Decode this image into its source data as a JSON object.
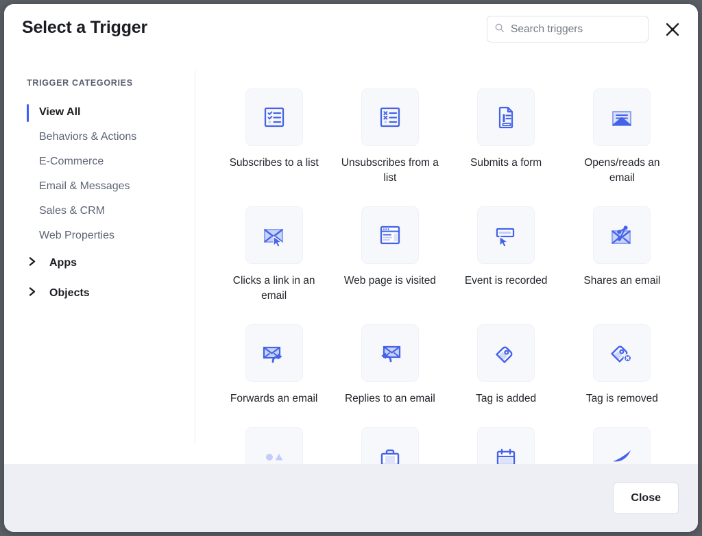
{
  "dialog": {
    "title": "Select a Trigger",
    "close_icon": "close-icon"
  },
  "search": {
    "placeholder": "Search triggers",
    "value": "",
    "icon": "search-icon"
  },
  "sidebar": {
    "heading": "TRIGGER CATEGORIES",
    "items": [
      {
        "label": "View All",
        "active": true
      },
      {
        "label": "Behaviors & Actions",
        "active": false
      },
      {
        "label": "E-Commerce",
        "active": false
      },
      {
        "label": "Email & Messages",
        "active": false
      },
      {
        "label": "Sales & CRM",
        "active": false
      },
      {
        "label": "Web Properties",
        "active": false
      }
    ],
    "groups": [
      {
        "label": "Apps",
        "icon": "chevron-right-icon"
      },
      {
        "label": "Objects",
        "icon": "chevron-right-icon"
      }
    ]
  },
  "triggers": [
    {
      "label": "Subscribes to a list",
      "icon": "list-check-icon"
    },
    {
      "label": "Unsubscribes from a list",
      "icon": "list-x-icon"
    },
    {
      "label": "Submits a form",
      "icon": "document-form-icon"
    },
    {
      "label": "Opens/reads an email",
      "icon": "envelope-open-icon"
    },
    {
      "label": "Clicks a link in an email",
      "icon": "envelope-cursor-icon"
    },
    {
      "label": "Web page is visited",
      "icon": "browser-window-icon"
    },
    {
      "label": "Event is recorded",
      "icon": "tooltip-cursor-icon"
    },
    {
      "label": "Shares an email",
      "icon": "envelope-share-icon"
    },
    {
      "label": "Forwards an email",
      "icon": "envelope-forward-icon"
    },
    {
      "label": "Replies to an email",
      "icon": "envelope-reply-icon"
    },
    {
      "label": "Tag is added",
      "icon": "tag-icon"
    },
    {
      "label": "Tag is removed",
      "icon": "tag-remove-icon"
    },
    {
      "label": "",
      "icon": "shapes-icon"
    },
    {
      "label": "",
      "icon": "briefcase-icon"
    },
    {
      "label": "",
      "icon": "calendar-icon"
    },
    {
      "label": "",
      "icon": "swoosh-icon"
    }
  ],
  "footer": {
    "close_label": "Close"
  },
  "colors": {
    "accent": "#3b5bfd",
    "icon_blue": "#4463e8",
    "icon_blue_light": "#c3cdf8",
    "tile_bg": "#f7f8fc",
    "footer_bg": "#edeff4"
  }
}
